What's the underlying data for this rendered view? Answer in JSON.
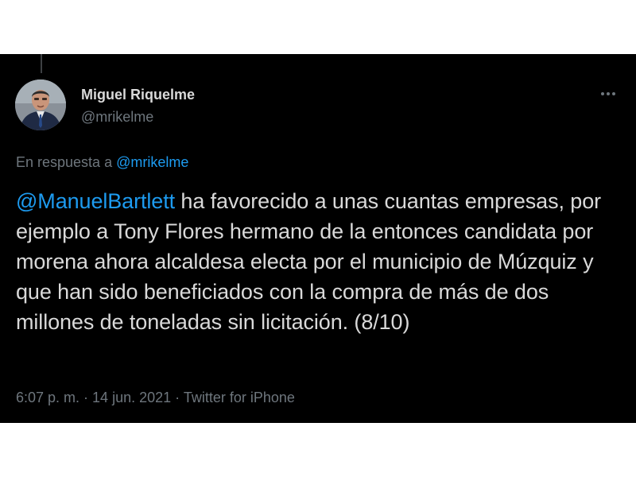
{
  "author": {
    "display_name": "Miguel Riquelme",
    "handle": "@mrikelme"
  },
  "reply_context": {
    "prefix": "En respuesta a ",
    "mention": "@mrikelme"
  },
  "tweet": {
    "mention": "@ManuelBartlett",
    "text": " ha favorecido a unas cuantas empresas, por ejemplo a Tony Flores hermano de la entonces candidata por morena ahora alcaldesa electa por el municipio de Múzquiz y que han sido beneficiados con la compra de más de dos millones de toneladas sin licitación. (8/10)"
  },
  "meta": {
    "time": "6:07 p. m.",
    "separator_1": " · ",
    "date": "14 jun. 2021",
    "separator_2": " · ",
    "source": "Twitter for iPhone"
  },
  "icons": {
    "more": "more-horizontal-icon",
    "avatar": "profile-photo"
  },
  "colors": {
    "background": "#000000",
    "text": "#d9d9d9",
    "secondary": "#6e767d",
    "link": "#1d9bf0"
  }
}
